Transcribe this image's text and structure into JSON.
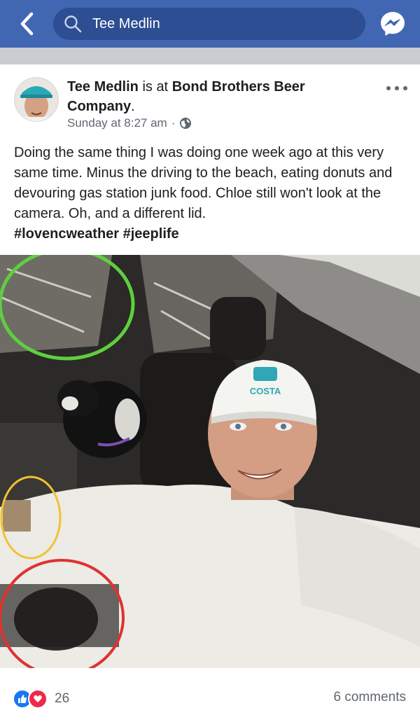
{
  "topbar": {
    "search_query": "Tee Medlin",
    "icons": {
      "back": "chevron-left-icon",
      "search": "search-icon",
      "messenger": "messenger-icon"
    },
    "colors": {
      "bar": "#4267b2",
      "pill": "#2d4e92"
    }
  },
  "post": {
    "author": "Tee Medlin",
    "is_at": "is at",
    "place": "Bond Brothers Beer Company",
    "place_suffix": ".",
    "timestamp": "Sunday at 8:27 am",
    "separator": "·",
    "text": "Doing the same thing I was doing one week ago at this very same time. Minus the driving to the beach, eating donuts and devouring gas station junk food. Chloe still won't look at the camera. Oh, and a different lid.",
    "hashtags": "#lovencweather #jeeplife",
    "photo": {
      "cap_logo": "COSTA",
      "annotation_colors": {
        "green": "#5fcf3e",
        "yellow": "#f1c232",
        "red": "#e03131"
      }
    },
    "reaction_count": "26",
    "comments": "6 comments"
  }
}
